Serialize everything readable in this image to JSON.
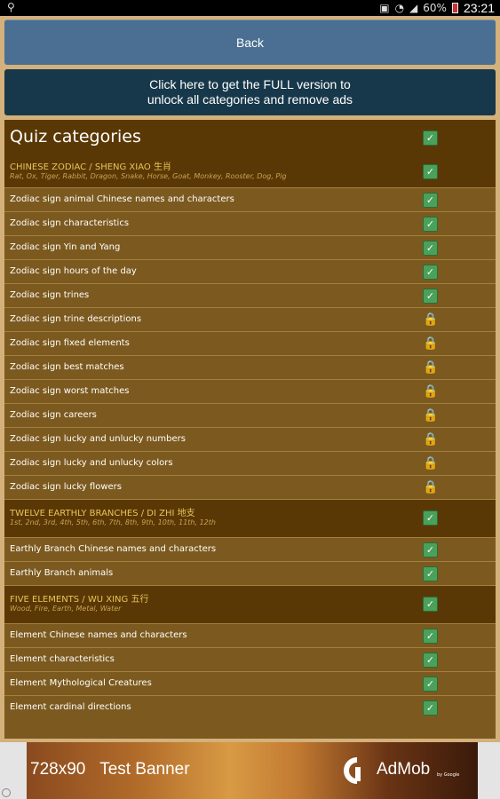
{
  "status_bar": {
    "usb_icon": "usb-icon",
    "battery": "60%",
    "time": "23:21"
  },
  "back_button": "Back",
  "full_version": [
    "Click here to get the FULL version to",
    "unlock all categories and remove ads"
  ],
  "panel": {
    "title": "Quiz categories",
    "sections": [
      {
        "title": "CHINESE ZODIAC / SHENG XIAO 生肖",
        "subtitle": "Rat, Ox, Tiger, Rabbit, Dragon, Snake, Horse, Goat, Monkey, Rooster, Dog, Pig",
        "items": [
          {
            "label": "Zodiac sign animal Chinese names and characters",
            "state": "checked"
          },
          {
            "label": "Zodiac sign characteristics",
            "state": "checked"
          },
          {
            "label": "Zodiac sign Yin and Yang",
            "state": "checked"
          },
          {
            "label": "Zodiac sign hours of the day",
            "state": "checked"
          },
          {
            "label": "Zodiac sign trines",
            "state": "checked"
          },
          {
            "label": "Zodiac sign trine descriptions",
            "state": "locked"
          },
          {
            "label": "Zodiac sign fixed elements",
            "state": "locked"
          },
          {
            "label": "Zodiac sign best matches",
            "state": "locked"
          },
          {
            "label": "Zodiac sign worst matches",
            "state": "locked"
          },
          {
            "label": "Zodiac sign careers",
            "state": "locked"
          },
          {
            "label": "Zodiac sign lucky and unlucky numbers",
            "state": "locked"
          },
          {
            "label": "Zodiac sign lucky and unlucky colors",
            "state": "locked"
          },
          {
            "label": "Zodiac sign lucky flowers",
            "state": "locked"
          }
        ]
      },
      {
        "title": "TWELVE EARTHLY BRANCHES / DI ZHI 地支",
        "subtitle": "1st, 2nd, 3rd, 4th, 5th, 6th, 7th, 8th, 9th, 10th, 11th, 12th",
        "items": [
          {
            "label": "Earthly Branch Chinese names and characters",
            "state": "checked"
          },
          {
            "label": "Earthly Branch animals",
            "state": "checked"
          }
        ]
      },
      {
        "title": "FIVE ELEMENTS / WU XING 五行",
        "subtitle": "Wood, Fire, Earth, Metal, Water",
        "items": [
          {
            "label": "Element Chinese names and characters",
            "state": "checked"
          },
          {
            "label": "Element characteristics",
            "state": "checked"
          },
          {
            "label": "Element Mythological Creatures",
            "state": "checked"
          },
          {
            "label": "Element cardinal directions",
            "state": "checked"
          }
        ]
      }
    ]
  },
  "ad": {
    "size": "728x90",
    "label": "Test Banner",
    "brand": "AdMob",
    "by": "by Google"
  }
}
